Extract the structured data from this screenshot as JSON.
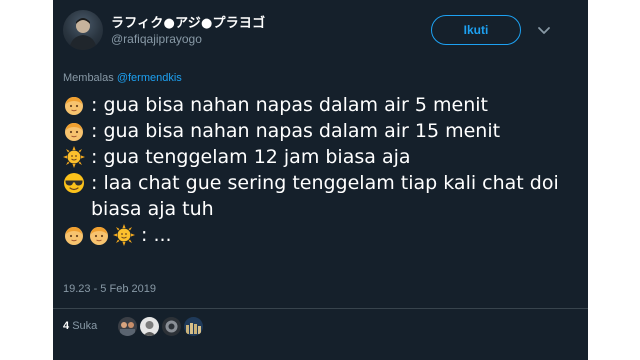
{
  "tweet": {
    "author": {
      "display_name": "ラフィク●アジ●プラヨゴ",
      "username": "@rafiqajiprayogo",
      "avatar_icon": "profile-photo"
    },
    "follow_label": "Ikuti",
    "reply_prefix": "Membalas",
    "reply_handle": "@fermendkis",
    "lines": [
      {
        "emoji": [
          "person-face"
        ],
        "text": ": gua bisa nahan napas dalam air 5 menit"
      },
      {
        "emoji": [
          "person-face"
        ],
        "text": ": gua bisa nahan napas dalam air 15 menit"
      },
      {
        "emoji": [
          "sun-with-face"
        ],
        "text": ": gua tenggelam 12 jam biasa aja"
      },
      {
        "emoji": [
          "smiling-face-with-sunglasses"
        ],
        "text": ": laa chat gue sering tenggelam tiap kali chat doi biasa aja tuh"
      },
      {
        "emoji": [
          "person-face",
          "person-face",
          "sun-with-face"
        ],
        "text": ": ..."
      }
    ],
    "timestamp": "19.23 - 5 Feb 2019",
    "likes": {
      "count": "4",
      "label": "Suka"
    }
  },
  "colors": {
    "background": "#15202b",
    "accent": "#1da1f2",
    "secondary_text": "#8899a6",
    "divider": "#38444d"
  }
}
